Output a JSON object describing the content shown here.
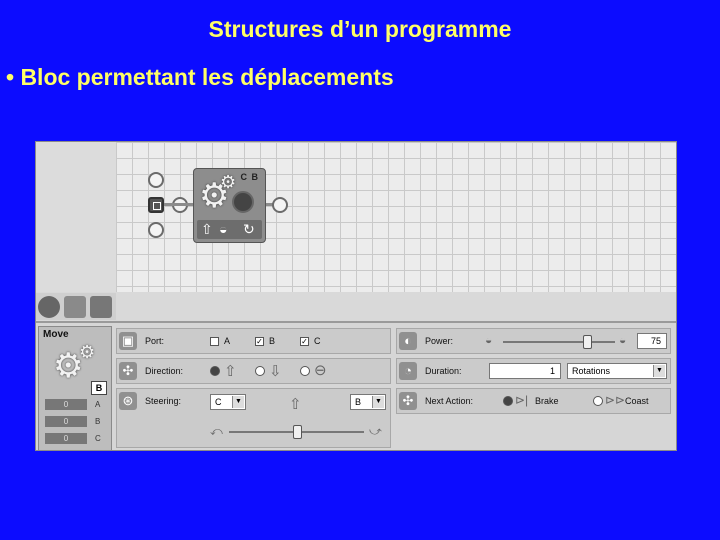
{
  "slide": {
    "title": "Structures d’un programme",
    "bullet": "• Bloc permettant les déplacements"
  },
  "block": {
    "ports": "C B"
  },
  "panel": {
    "move_label": "Move",
    "ports_chip": "B",
    "feedback": [
      {
        "value": "0",
        "port": "A"
      },
      {
        "value": "0",
        "port": "B"
      },
      {
        "value": "0",
        "port": "C"
      }
    ],
    "port": {
      "label": "Port:",
      "options": [
        "A",
        "B",
        "C"
      ],
      "checked": [
        "B",
        "C"
      ]
    },
    "direction": {
      "label": "Direction:",
      "options": [
        "forward",
        "backward",
        "stop"
      ],
      "selected": "forward"
    },
    "steering": {
      "label": "Steering:",
      "left_port": "C",
      "right_port": "B",
      "position": 0.5
    },
    "power": {
      "label": "Power:",
      "value": "75",
      "level": 0.75
    },
    "duration": {
      "label": "Duration:",
      "value": "1",
      "unit": "Rotations"
    },
    "next_action": {
      "label": "Next Action:",
      "options": [
        "Brake",
        "Coast"
      ],
      "selected": "Brake"
    }
  },
  "colors": {
    "background": "#0c0cff",
    "text": "#ffff66"
  }
}
